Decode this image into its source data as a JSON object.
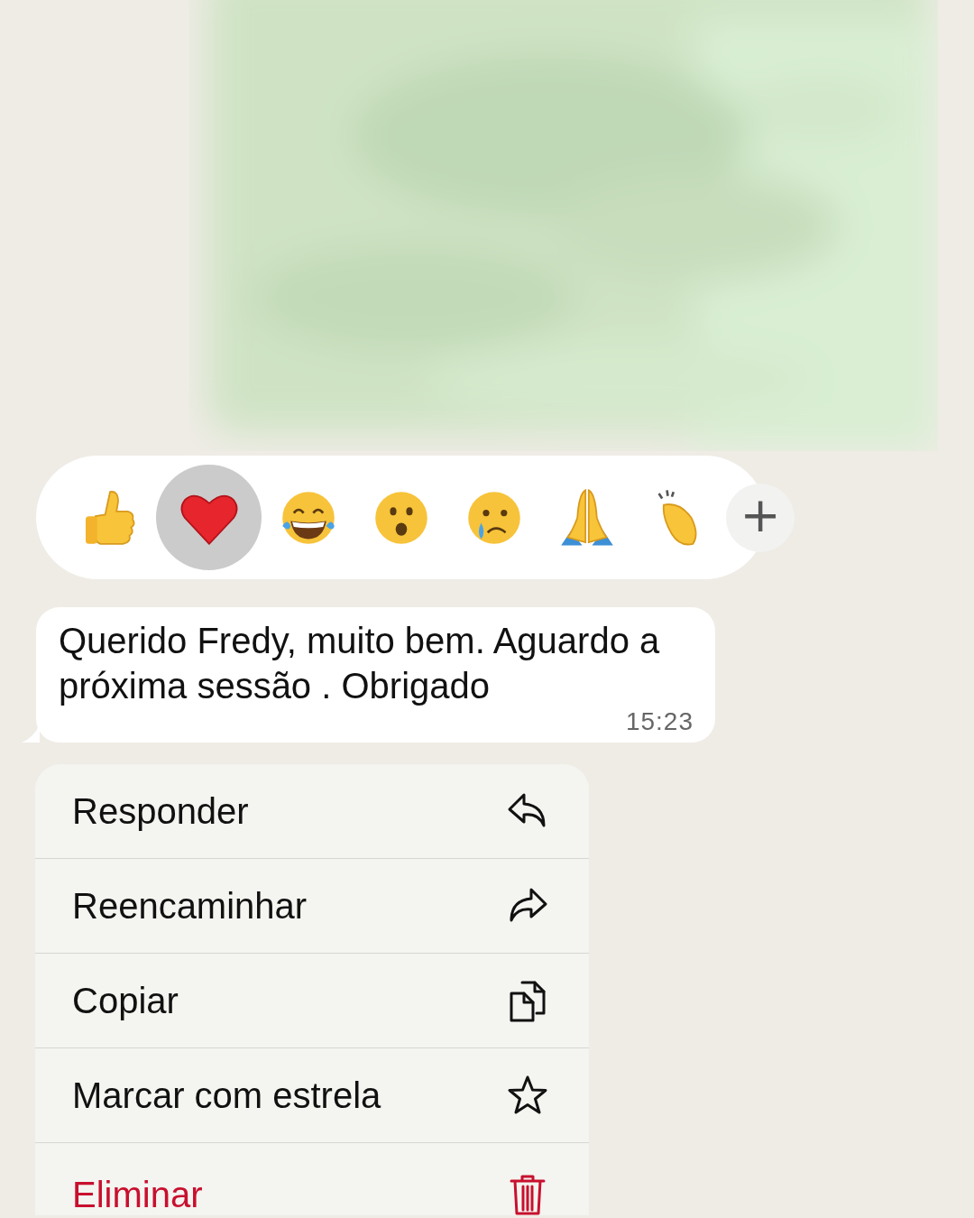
{
  "reactions": [
    {
      "kind": "thumbs-up",
      "selected": false
    },
    {
      "kind": "heart",
      "selected": true
    },
    {
      "kind": "laughing",
      "selected": false
    },
    {
      "kind": "surprised",
      "selected": false
    },
    {
      "kind": "crying",
      "selected": false
    },
    {
      "kind": "praying",
      "selected": false
    },
    {
      "kind": "clapping",
      "selected": false
    }
  ],
  "more_button": {
    "symbol": "+"
  },
  "message": {
    "text": "Querido Fredy, muito bem. Aguardo a próxima sessão . Obrigado",
    "time": "15:23"
  },
  "menu": [
    {
      "label": "Responder",
      "kind": "reply",
      "destructive": false
    },
    {
      "label": "Reencaminhar",
      "kind": "forward",
      "destructive": false
    },
    {
      "label": "Copiar",
      "kind": "copy",
      "destructive": false
    },
    {
      "label": "Marcar com estrela",
      "kind": "star",
      "destructive": false
    },
    {
      "label": "Eliminar",
      "kind": "delete",
      "destructive": true
    }
  ]
}
